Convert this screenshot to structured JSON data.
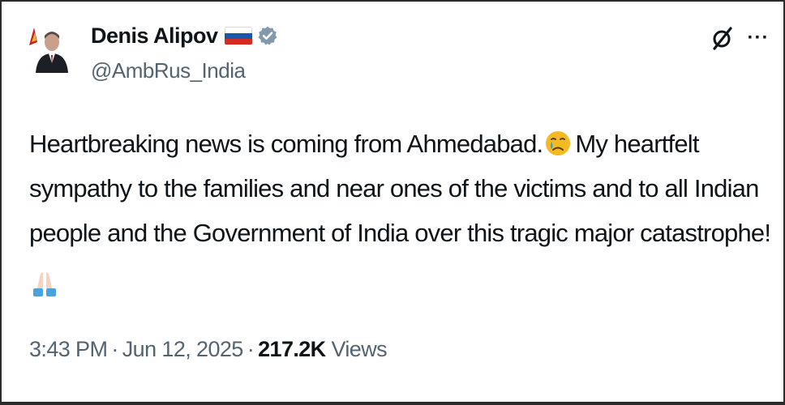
{
  "author": {
    "display_name": "Denis Alipov",
    "handle": "@AmbRus_India",
    "flag": "russia-flag",
    "verified_badge": "verified-badge-icon",
    "verified_color": "#829aab"
  },
  "header_actions": {
    "grok_icon": "grok-icon",
    "more_icon": "more-options-icon",
    "more_glyph": "···"
  },
  "tweet": {
    "lines": [
      "Heartbreaking news is coming from Ahmedabad.",
      "My heartfelt",
      "sympathy to the families and near ones of the victims and to all Indian",
      "people and the Government of India over this tragic major catastrophe!"
    ],
    "emoji_1": "crying-face-emoji",
    "emoji_2": "folded-hands-emoji"
  },
  "meta": {
    "time": "3:43 PM",
    "date": "Jun 12, 2025",
    "views_count": "217.2K",
    "views_label": "Views",
    "separator": "·"
  },
  "colors": {
    "text_primary": "#0f1419",
    "text_secondary": "#536471",
    "flag_white": "#ffffff",
    "flag_blue": "#1c57a7",
    "flag_red": "#d52b1e"
  }
}
